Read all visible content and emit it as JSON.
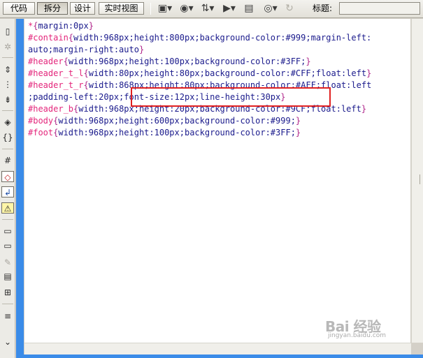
{
  "toolbar": {
    "view_buttons": [
      "代码",
      "拆分",
      "设计",
      "实时视图"
    ],
    "active_view": "拆分",
    "title_label": "标题:",
    "title_value": ""
  },
  "code_lines": [
    [
      {
        "t": "*",
        "c": "sel"
      },
      {
        "t": "{",
        "c": "brace"
      },
      {
        "t": "margin:0px",
        "c": "prop"
      },
      {
        "t": "}",
        "c": "brace"
      }
    ],
    [
      {
        "t": "#contain",
        "c": "sel"
      },
      {
        "t": "{",
        "c": "brace"
      },
      {
        "t": "width:968px;height:800px;background-color:#999;margin-left:",
        "c": "prop"
      }
    ],
    [
      {
        "t": "auto;margin-right:auto",
        "c": "prop"
      },
      {
        "t": "}",
        "c": "brace"
      }
    ],
    [
      {
        "t": "#header",
        "c": "sel"
      },
      {
        "t": "{",
        "c": "brace"
      },
      {
        "t": "width:968px;height:100px;background-color:#3FF;",
        "c": "prop"
      },
      {
        "t": "}",
        "c": "brace"
      }
    ],
    [
      {
        "t": "#header_t_l",
        "c": "sel"
      },
      {
        "t": "{",
        "c": "brace"
      },
      {
        "t": "width:80px;height:80px;background-color:#CFF;float:left",
        "c": "prop"
      },
      {
        "t": "}",
        "c": "brace"
      }
    ],
    [
      {
        "t": "#header_t_r",
        "c": "sel"
      },
      {
        "t": "{",
        "c": "brace"
      },
      {
        "t": "width:868px;height:80px;background-color:#AFF;float:left",
        "c": "prop"
      }
    ],
    [
      {
        "t": ";padding-left:20px",
        "c": "prop"
      },
      {
        "t": ";",
        "c": "prop"
      },
      {
        "t": "font-size:12px;line-height:30px",
        "c": "prop"
      },
      {
        "t": "}",
        "c": "brace"
      }
    ],
    [
      {
        "t": "#header_b",
        "c": "sel"
      },
      {
        "t": "{",
        "c": "brace"
      },
      {
        "t": "width:968px;height:20px;background-color:#9CF;float:left",
        "c": "prop"
      },
      {
        "t": "}",
        "c": "brace"
      }
    ],
    [
      {
        "t": "#body",
        "c": "sel"
      },
      {
        "t": "{",
        "c": "brace"
      },
      {
        "t": "width:968px;height:600px;background-color:#999;",
        "c": "prop"
      },
      {
        "t": "}",
        "c": "brace"
      }
    ],
    [
      {
        "t": "#foot",
        "c": "sel"
      },
      {
        "t": "{",
        "c": "brace"
      },
      {
        "t": "width:968px;height:100px;background-color:#3FF;",
        "c": "prop"
      },
      {
        "t": "}",
        "c": "brace"
      }
    ]
  ],
  "watermark": {
    "brand": "Bai 经验",
    "sub": "jingyan.baidu.com"
  }
}
